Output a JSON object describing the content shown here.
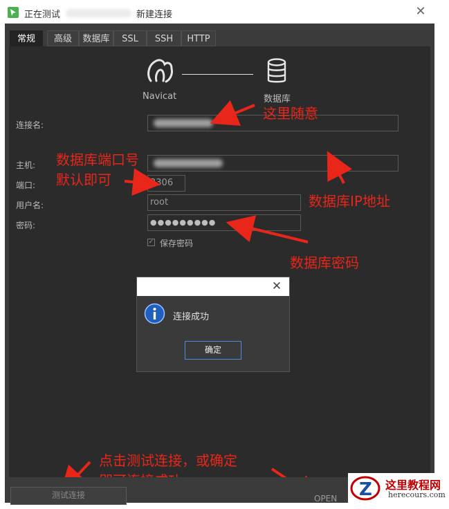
{
  "window": {
    "title_prefix": "正在测试",
    "title_suffix": "新建连接",
    "close": "✕"
  },
  "tabs": [
    {
      "label": "常规",
      "active": true
    },
    {
      "label": "高级"
    },
    {
      "label": "数据库"
    },
    {
      "label": "SSL"
    },
    {
      "label": "SSH"
    },
    {
      "label": "HTTP"
    }
  ],
  "header": {
    "left_label": "Navicat",
    "right_label": "数据库",
    "left_icon": "navicat-icon",
    "right_icon": "database-icon"
  },
  "form": {
    "conn_name_label": "连接名:",
    "host_label": "主机:",
    "port_label": "端口:",
    "port_value": "3306",
    "user_label": "用户名:",
    "user_value": "root",
    "password_label": "密码:",
    "password_value": "●●●●●●●●●",
    "save_password_label": "保存密码",
    "save_password_checked": true
  },
  "annotations": {
    "conn_name": "这里随意",
    "port_line1": "数据库端口号",
    "port_line2": "默认即可",
    "host": "数据库IP地址",
    "password": "数据库密码",
    "bottom_line1": "点击测试连接，或确定",
    "bottom_line2": "即可连接成功",
    "color": "#e8261a"
  },
  "message_box": {
    "close": "✕",
    "text": "连接成功",
    "ok": "确定",
    "icon": "info-icon"
  },
  "bottom": {
    "test_button": "测试连接",
    "open_button": "OPEN"
  },
  "watermark": {
    "title": "这里教程网",
    "url": "herecours.com"
  }
}
